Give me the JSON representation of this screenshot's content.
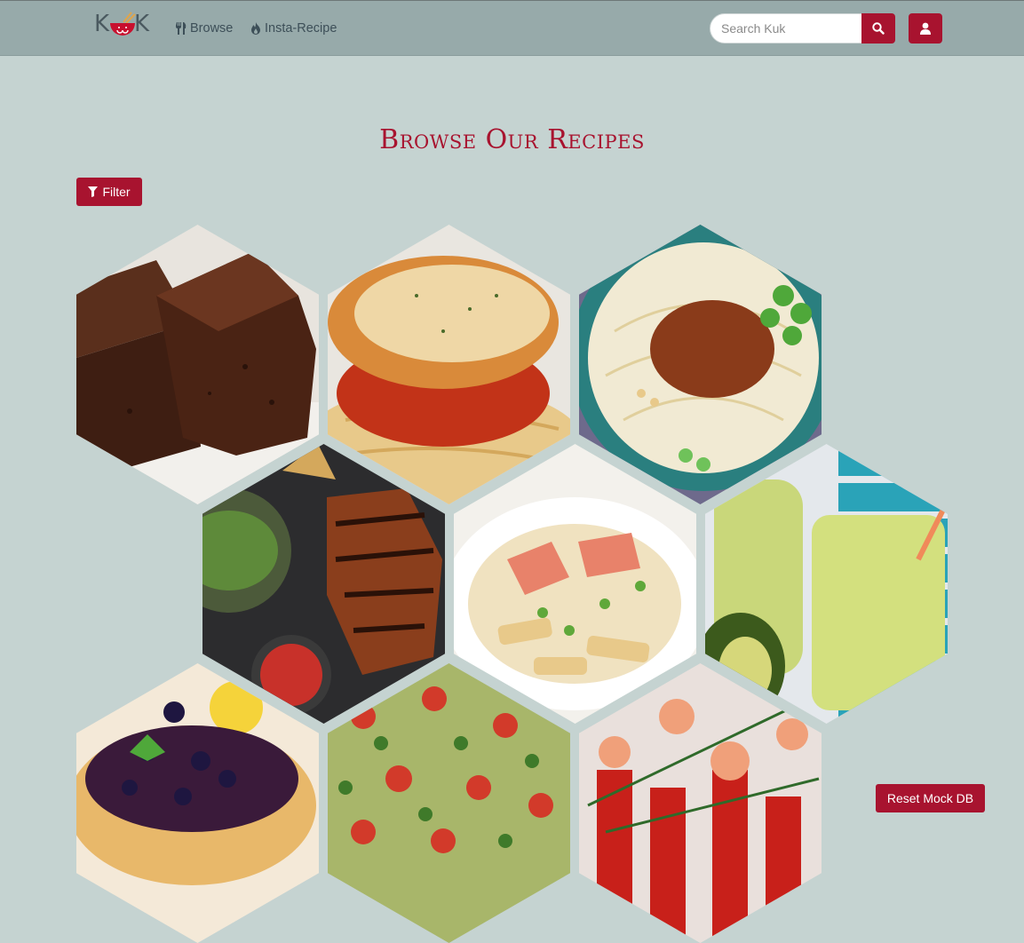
{
  "brand": {
    "logo_left": "K",
    "logo_right": "K",
    "logo_icon": "bowl-with-chopsticks-icon"
  },
  "nav": {
    "browse_label": "Browse",
    "browse_icon": "cutlery-icon",
    "insta_label": "Insta-Recipe",
    "insta_icon": "fire-icon"
  },
  "search": {
    "placeholder": "Search Kuk",
    "value": "",
    "button_icon": "search-icon"
  },
  "user": {
    "icon": "user-icon"
  },
  "main": {
    "title": "Browse Our Recipes",
    "filter_label": "Filter",
    "filter_icon": "filter-icon"
  },
  "recipes": [
    {
      "image": "brownies"
    },
    {
      "image": "chicken-parmesan-spaghetti"
    },
    {
      "image": "noodle-bowl-with-meat-sauce"
    },
    {
      "image": "grilled-chicken-with-greens"
    },
    {
      "image": "salmon-penne-pasta"
    },
    {
      "image": "avocado-smoothie"
    },
    {
      "image": "blueberry-pancakes"
    },
    {
      "image": "tabbouleh-salad"
    },
    {
      "image": "shrimp-appetizer-shots"
    }
  ],
  "reset_label": "Reset Mock DB",
  "colors": {
    "accent": "#a8132f",
    "navbar": "#97aaaa",
    "background": "#c5d3d1",
    "nav_text": "#3d4f58"
  }
}
